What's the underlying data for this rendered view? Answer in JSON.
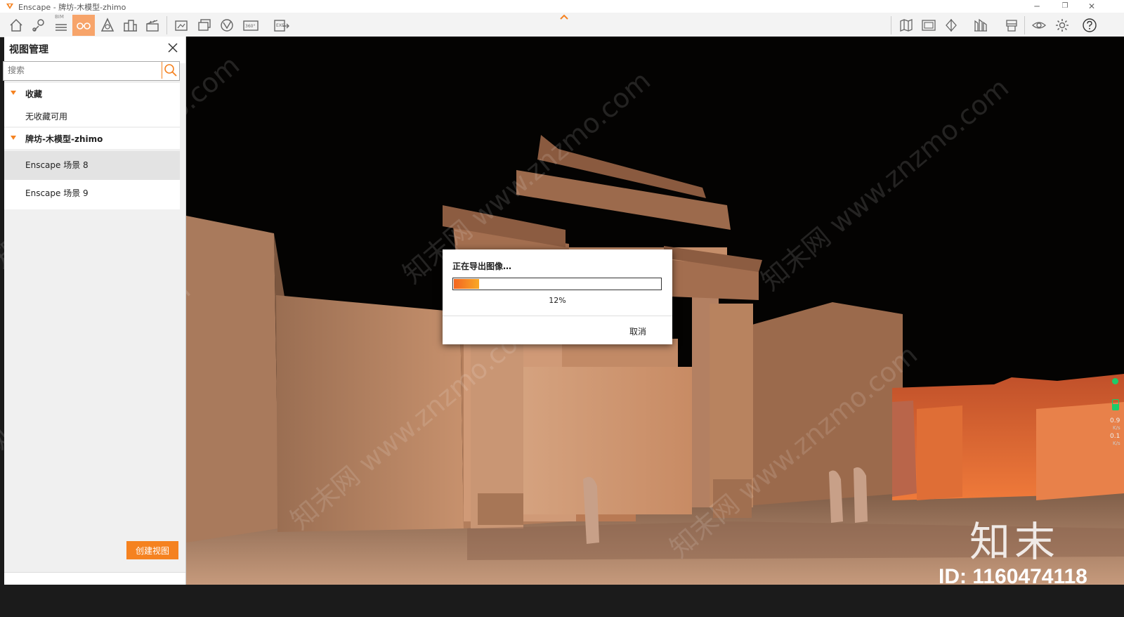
{
  "window": {
    "title": "Enscape - 牌坊-木模型-zhimo",
    "controls": [
      "minimize",
      "restore",
      "close"
    ]
  },
  "toolbar": {
    "bim_label": "BIM",
    "panorama_label": "360°",
    "exe_label": "EXE",
    "left_icons": [
      "home-icon",
      "location-icon",
      "bim-icon",
      "views-icon",
      "visual-settings-icon",
      "buildings-icon",
      "clapper-icon",
      "screenshot-icon",
      "batch-render-icon",
      "video-icon",
      "panorama-icon",
      "export-exe-icon"
    ],
    "right_icons": [
      "map-icon",
      "bim-info-icon",
      "split-view-icon",
      "asset-library-icon",
      "vr-headset-icon",
      "eye-icon",
      "settings-gear-icon",
      "help-icon"
    ],
    "active_icon": "views-icon"
  },
  "panel": {
    "title": "视图管理",
    "search_placeholder": "搜索",
    "groups": [
      {
        "label": "收藏",
        "items": [
          {
            "label": "无收藏可用"
          }
        ]
      },
      {
        "label": "牌坊-木模型-zhimo",
        "items": [
          {
            "label": "Enscape 场景 8",
            "selected": true
          },
          {
            "label": "Enscape 场景 9"
          }
        ]
      }
    ],
    "create_button": "创建视图"
  },
  "dialog": {
    "title": "正在导出图像…",
    "progress": 0.12,
    "progress_text": "12%",
    "cancel_label": "取消"
  },
  "indicators": {
    "upload_value": "0.9",
    "upload_unit": "K/s",
    "download_value": "0.1",
    "download_unit": "K/s"
  },
  "watermark": {
    "brand": "知末",
    "id_text": "ID: 1160474118",
    "pattern": "知末网 www.znzmo.com"
  },
  "colors": {
    "accent": "#f58220",
    "active_tool": "#f7a46a",
    "status_green": "#1bcc6a"
  }
}
